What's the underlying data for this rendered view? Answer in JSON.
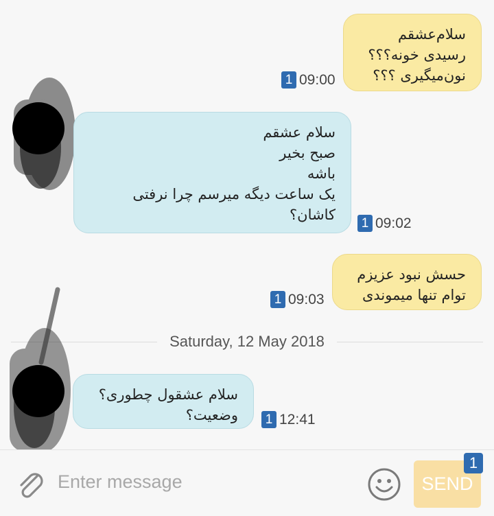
{
  "messages": [
    {
      "direction": "outgoing",
      "text": "سلام‌عشقم\nرسیدی خونه؟؟؟\nنون‌میگیری ؟؟؟",
      "badge": "1",
      "time": "09:00"
    },
    {
      "direction": "incoming",
      "text": "سلام عشقم\nصبح بخیر\nباشه\nیک ساعت دیگه میرسم چرا نرفتی\nکاشان؟",
      "badge": "1",
      "time": "09:02"
    },
    {
      "direction": "outgoing",
      "text": "حسش نبود عزیزم\nتوام تنها میموندی",
      "badge": "1",
      "time": "09:03"
    },
    {
      "direction": "incoming",
      "text": "سلام عشقول چطوری؟\nوضعیت؟",
      "badge": "1",
      "time": "12:41"
    }
  ],
  "date_separator": "Saturday, 12 May 2018",
  "composer": {
    "placeholder": "Enter message",
    "send_label": "SEND",
    "send_badge": "1",
    "attach_icon": "paperclip-icon",
    "emoji_icon": "smiley-icon"
  },
  "colors": {
    "outgoing_bubble": "#faeaa3",
    "incoming_bubble": "#d2ecf1",
    "badge": "#2f6bb0",
    "send_button": "#f9dfa4"
  }
}
